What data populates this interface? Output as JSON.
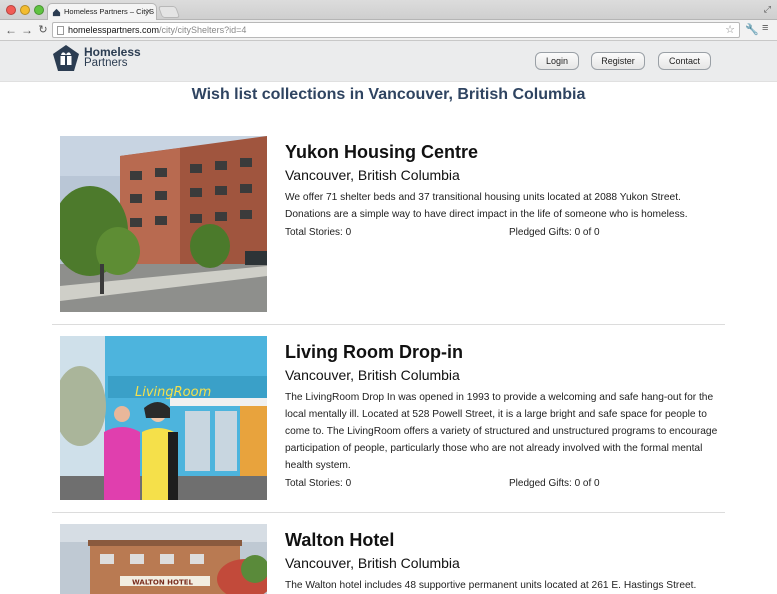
{
  "browser": {
    "tab_title": "Homeless Partners – CityS",
    "url_host": "homelesspartners.com",
    "url_path": "/city/cityShelters?id=4"
  },
  "site": {
    "logo_line1": "Homeless",
    "logo_line2": "Partners",
    "nav": {
      "login": "Login",
      "register": "Register",
      "contact": "Contact"
    }
  },
  "page": {
    "title": "Wish list collections in Vancouver, British Columbia"
  },
  "shelters": [
    {
      "name": "Yukon Housing Centre",
      "city": "Vancouver, British Columbia",
      "description": "We offer 71 shelter beds and 37 transitional housing units located at 2088 Yukon Street. Donations are a simple way to have direct impact in the life of someone who is homeless.",
      "stories": "Total Stories: 0",
      "gifts": "Pledged Gifts: 0 of 0"
    },
    {
      "name": "Living Room Drop-in",
      "city": "Vancouver, British Columbia",
      "description": "The LivingRoom Drop In was opened in 1993 to provide a welcoming and safe hang-out for the local mentally ill. Located at 528 Powell Street, it is a large bright and safe space for people to come to. The LivingRoom offers a variety of structured and unstructured programs to encourage participation of people, particularly those who are not already involved with the formal mental health system.",
      "stories": "Total Stories: 0",
      "gifts": "Pledged Gifts: 0 of 0",
      "sign_text": "LivingRoom"
    },
    {
      "name": "Walton Hotel",
      "city": "Vancouver, British Columbia",
      "description": "The Walton hotel includes 48 supportive permanent units located at 261 E. Hastings Street.",
      "sign_text": "WALTON HOTEL"
    }
  ]
}
